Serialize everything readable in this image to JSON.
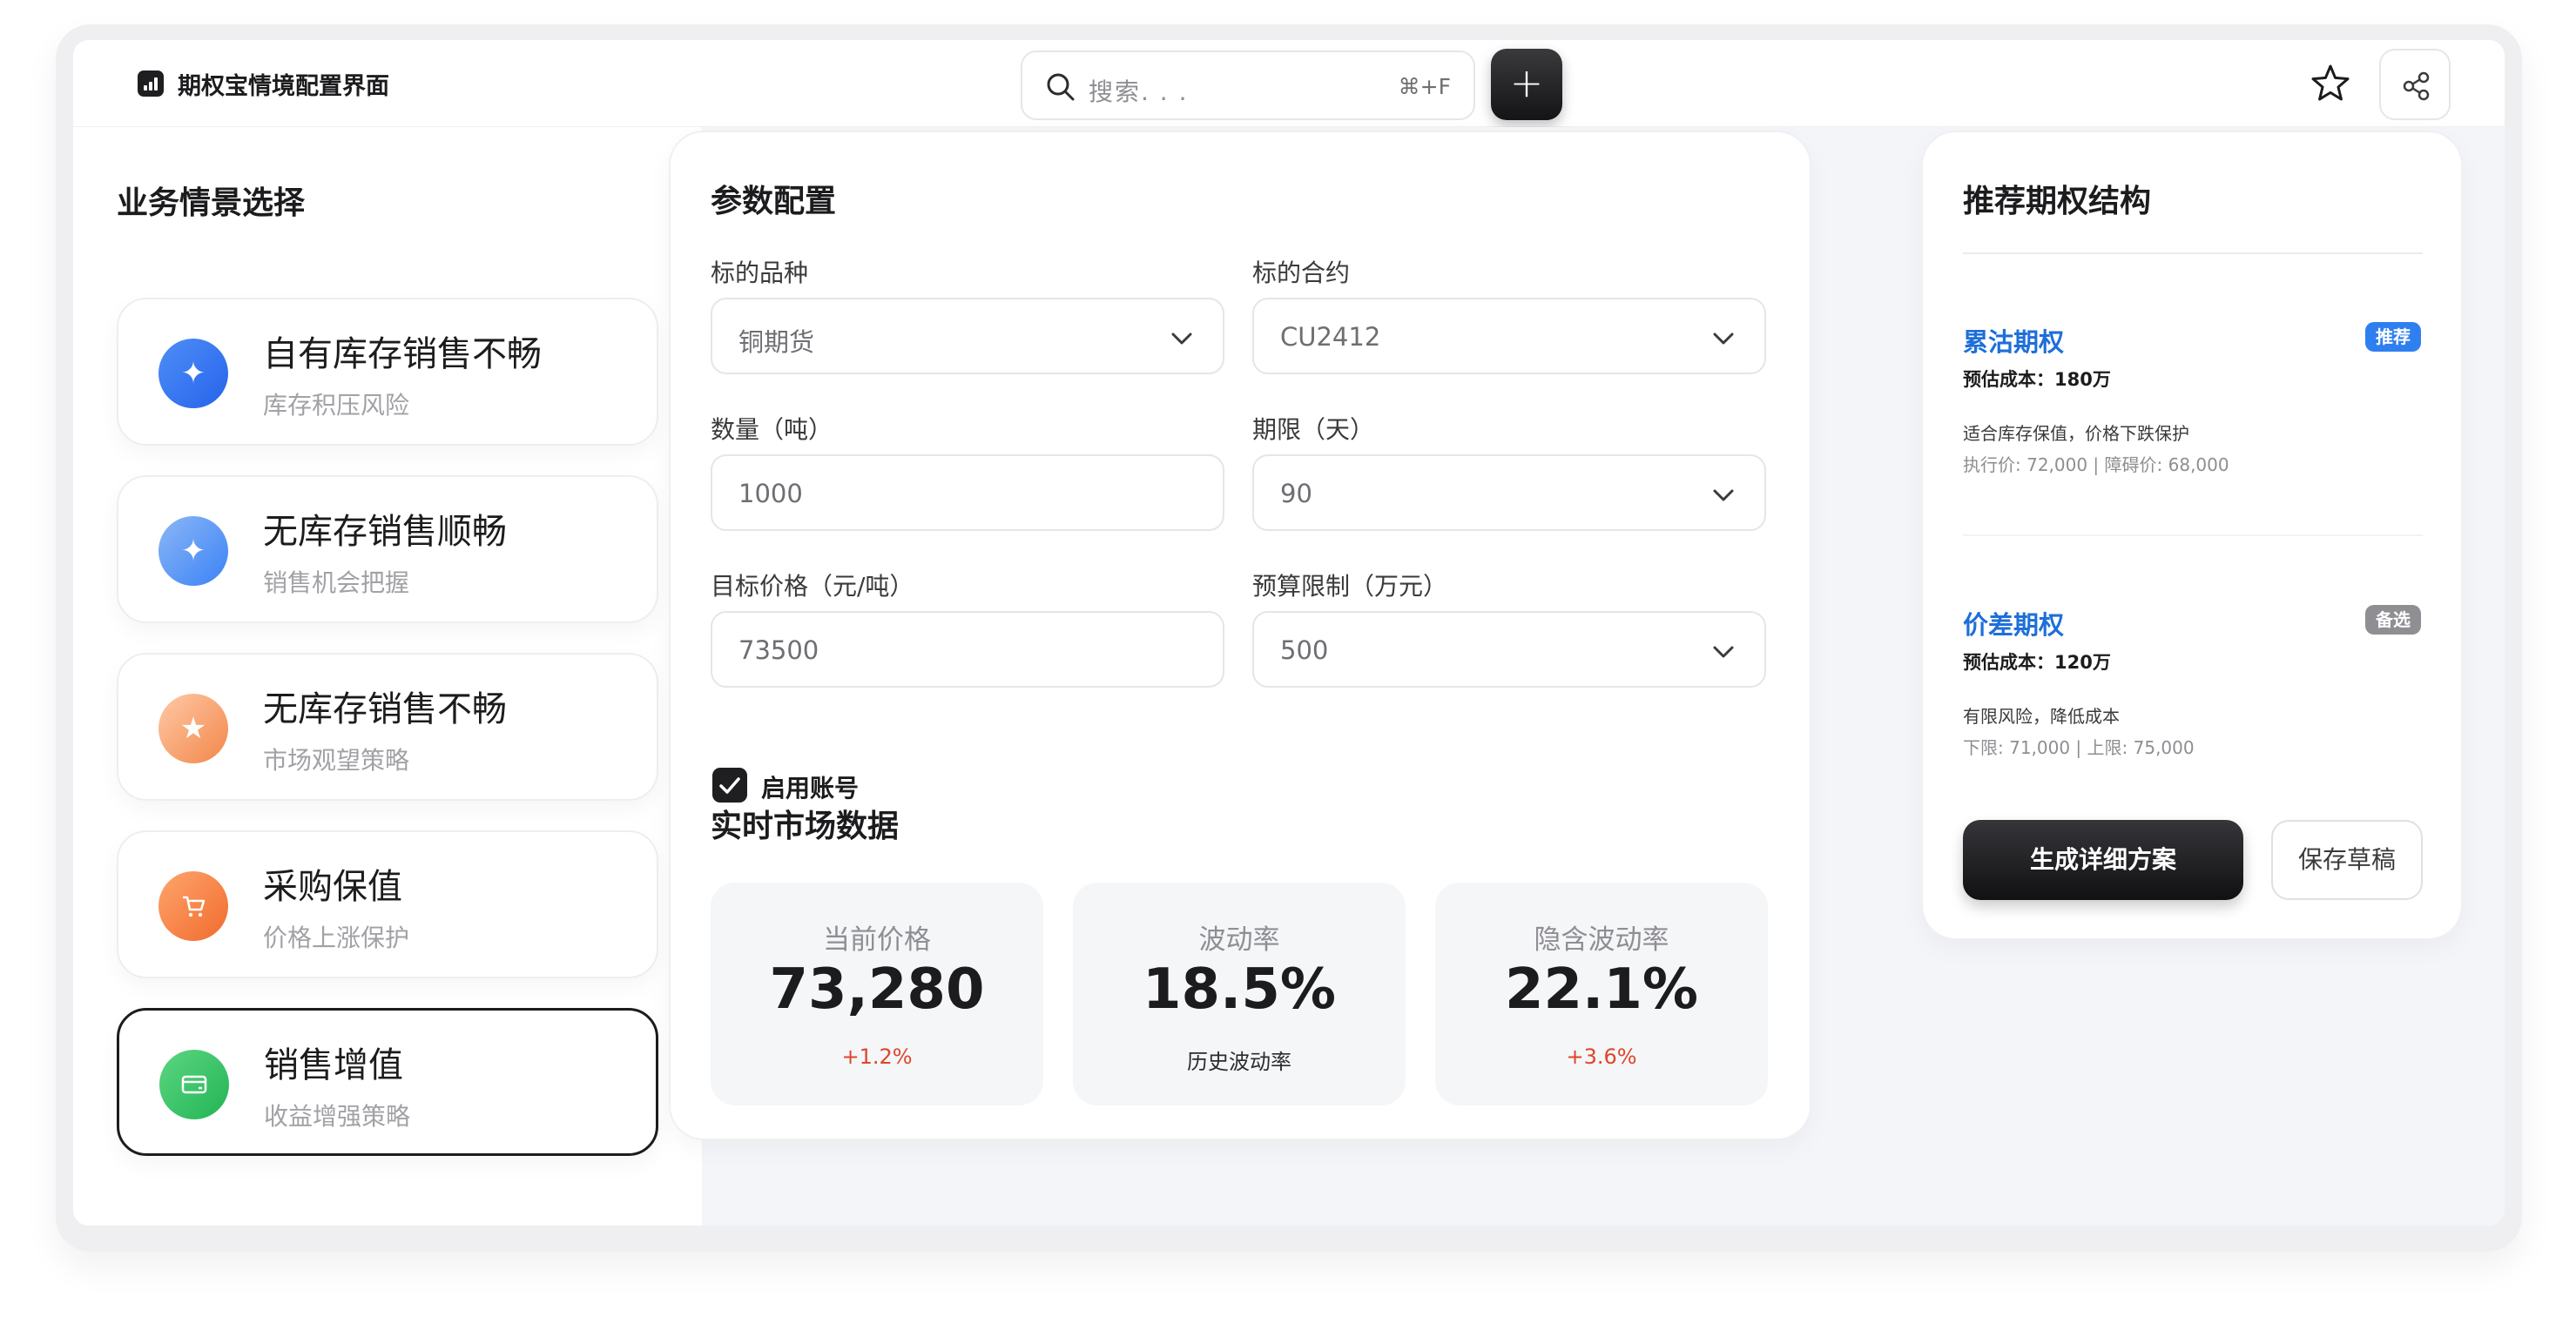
{
  "app": {
    "title": "期权宝情境配置界面"
  },
  "search": {
    "placeholder": "搜索. . .",
    "shortcut": "⌘+F"
  },
  "toolbar": {
    "add_label": "+"
  },
  "sidebar": {
    "title": "业务情景选择",
    "items": [
      {
        "title": "自有库存销售不畅",
        "subtitle": "库存积压风险",
        "icon": "sparkle-icon",
        "color_from": "#4f8ef7",
        "color_to": "#2563eb",
        "active": false
      },
      {
        "title": "无库存销售顺畅",
        "subtitle": "销售机会把握",
        "icon": "sparkle-icon",
        "color_from": "#8bb7f7",
        "color_to": "#3b82f6",
        "active": false
      },
      {
        "title": "无库存销售不畅",
        "subtitle": "市场观望策略",
        "icon": "star-icon",
        "color_from": "#ffc9a6",
        "color_to": "#f2874a",
        "active": false
      },
      {
        "title": "采购保值",
        "subtitle": "价格上涨保护",
        "icon": "cart-icon",
        "color_from": "#ffa56e",
        "color_to": "#f06b2c",
        "active": false
      },
      {
        "title": "销售增值",
        "subtitle": "收益增强策略",
        "icon": "card-icon",
        "color_from": "#5cd681",
        "color_to": "#22b455",
        "active": true
      }
    ]
  },
  "params": {
    "title": "参数配置",
    "underlying_label": "标的品种",
    "underlying_value": "铜期货",
    "contract_label": "标的合约",
    "contract_value": "CU2412",
    "quantity_label": "数量（吨）",
    "quantity_value": "1000",
    "term_label": "期限（天）",
    "term_value": "90",
    "target_price_label": "目标价格（元/吨）",
    "target_price_value": "73500",
    "budget_label": "预算限制（万元）",
    "budget_value": "500",
    "enable_account_label": "启用账号"
  },
  "market": {
    "title": "实时市场数据",
    "metrics": [
      {
        "label": "当前价格",
        "value": "73,280",
        "sub": "+1.2%",
        "sub_color": "red"
      },
      {
        "label": "波动率",
        "value": "18.5%",
        "sub": "历史波动率",
        "sub_color": "dark"
      },
      {
        "label": "隐含波动率",
        "value": "22.1%",
        "sub": "+3.6%",
        "sub_color": "red"
      }
    ]
  },
  "recommend": {
    "title": "推荐期权结构",
    "options": [
      {
        "name": "累沽期权",
        "badge": "推荐",
        "badge_color": "#2f7ff0",
        "cost": "预估成本：180万",
        "desc": "适合库存保值，价格下跌保护",
        "detail": "执行价: 72,000 | 障碍价: 68,000"
      },
      {
        "name": "价差期权",
        "badge": "备选",
        "badge_color": "#8e8e93",
        "cost": "预估成本：120万",
        "desc": "有限风险，降低成本",
        "detail": "下限: 71,000 | 上限: 75,000"
      }
    ],
    "generate_label": "生成详细方案",
    "draft_label": "保存草稿"
  }
}
